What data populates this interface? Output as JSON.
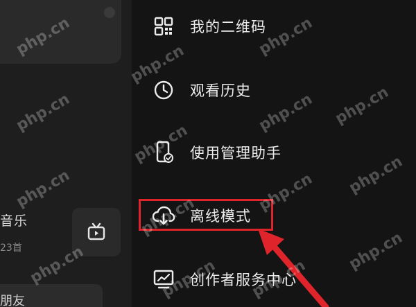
{
  "left_panel": {
    "music_title": "音乐",
    "music_count": "23首",
    "friends_text": "朋友"
  },
  "menu": {
    "items": [
      {
        "id": "qr",
        "label": "我的二维码",
        "icon": "qr-code-icon"
      },
      {
        "id": "history",
        "label": "观看历史",
        "icon": "clock-icon"
      },
      {
        "id": "usage",
        "label": "使用管理助手",
        "icon": "phone-check-icon"
      },
      {
        "id": "offline",
        "label": "离线模式",
        "icon": "cloud-download-icon"
      },
      {
        "id": "creator",
        "label": "创作者服务中心",
        "icon": "chart-monitor-icon"
      }
    ]
  },
  "annotation": {
    "highlight_color": "#e0242b",
    "arrow_color": "#e0242b"
  },
  "watermark": {
    "text": "php.cn"
  }
}
